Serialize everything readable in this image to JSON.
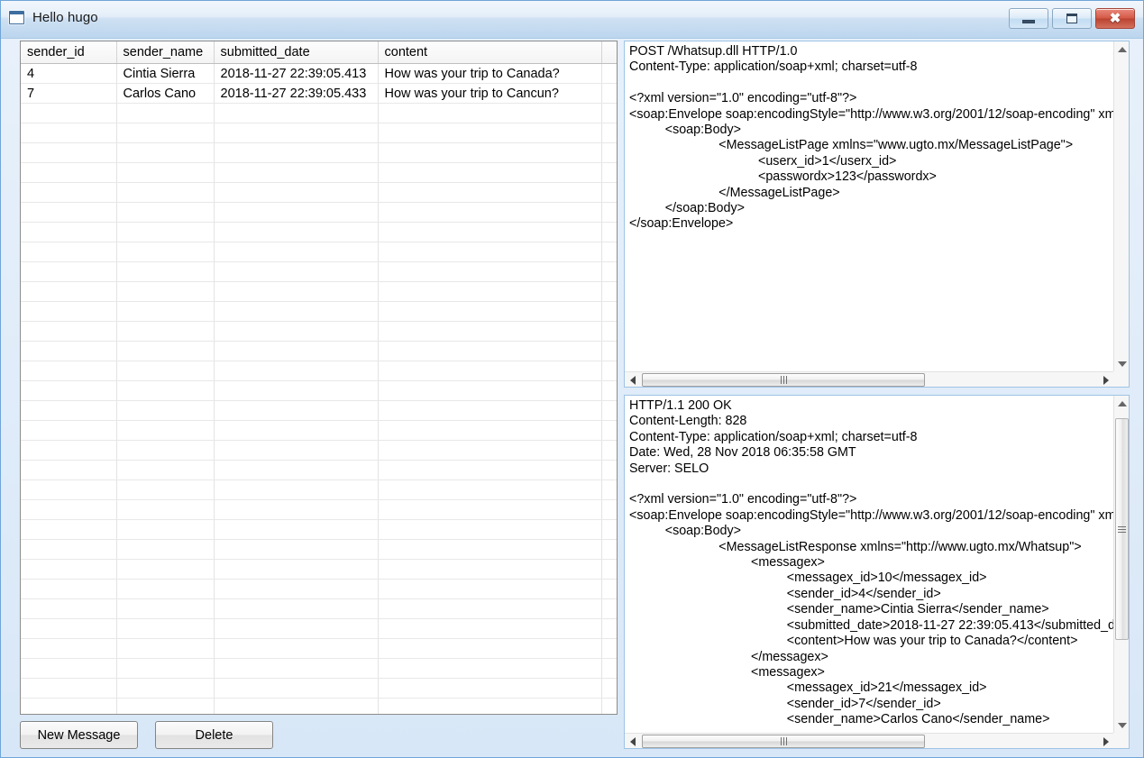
{
  "window": {
    "title": "Hello hugo",
    "icon": "window-icon",
    "buttons": {
      "minimize": "minimize",
      "maximize": "maximize",
      "close": "close"
    }
  },
  "table": {
    "columns": [
      "sender_id",
      "sender_name",
      "submitted_date",
      "content",
      ""
    ],
    "rows": [
      {
        "sender_id": "4",
        "sender_name": "Cintia Sierra",
        "submitted_date": "2018-11-27 22:39:05.413",
        "content": "How was your trip to Canada?",
        "pad": ""
      },
      {
        "sender_id": "7",
        "sender_name": "Carlos Cano",
        "submitted_date": "2018-11-27 22:39:05.433",
        "content": "How was your trip to Cancun?",
        "pad": ""
      }
    ],
    "empty_row_count": 32
  },
  "buttons": {
    "new_message": "New Message",
    "delete": "Delete"
  },
  "request_panel": {
    "name": "soap-request",
    "text": "POST /Whatsup.dll HTTP/1.0\nContent-Type: application/soap+xml; charset=utf-8\n\n<?xml version=\"1.0\" encoding=\"utf-8\"?>\n<soap:Envelope soap:encodingStyle=\"http://www.w3.org/2001/12/soap-encoding\" xmlns:soap=\"http://www.w3.org/2001/12/soap-envelope\">\n          <soap:Body>\n                         <MessageListPage xmlns=\"www.ugto.mx/MessageListPage\">\n                                    <userx_id>1</userx_id>\n                                    <passwordx>123</passwordx>\n                         </MessageListPage>\n          </soap:Body>\n</soap:Envelope>"
  },
  "response_panel": {
    "name": "soap-response",
    "text": "HTTP/1.1 200 OK\nContent-Length: 828\nContent-Type: application/soap+xml; charset=utf-8\nDate: Wed, 28 Nov 2018 06:35:58 GMT\nServer: SELO\n\n<?xml version=\"1.0\" encoding=\"utf-8\"?>\n<soap:Envelope soap:encodingStyle=\"http://www.w3.org/2001/12/soap-encoding\" xmlns:soap=\"http://www.w3.org/2001/12/soap-envelope\">\n          <soap:Body>\n                         <MessageListResponse xmlns=\"http://www.ugto.mx/Whatsup\">\n                                  <messagex>\n                                            <messagex_id>10</messagex_id>\n                                            <sender_id>4</sender_id>\n                                            <sender_name>Cintia Sierra</sender_name>\n                                            <submitted_date>2018-11-27 22:39:05.413</submitted_date>\n                                            <content>How was your trip to Canada?</content>\n                                  </messagex>\n                                  <messagex>\n                                            <messagex_id>21</messagex_id>\n                                            <sender_id>7</sender_id>\n                                            <sender_name>Carlos Cano</sender_name>"
  },
  "scrollbars": {
    "request_vertical": {
      "thumb_top_pct": 0,
      "thumb_height_pct": 0
    },
    "request_horizontal": {
      "thumb_left_pct": 2,
      "thumb_width_pct": 60
    },
    "response_vertical": {
      "thumb_top_pct": 3,
      "thumb_height_pct": 70
    },
    "response_horizontal": {
      "thumb_left_pct": 2,
      "thumb_width_pct": 60
    }
  },
  "colors": {
    "window_chrome": "#c0d8ef",
    "panel_border": "#9ec4e4",
    "close_button": "#d55a47",
    "grid_border": "#8c8c8c"
  }
}
